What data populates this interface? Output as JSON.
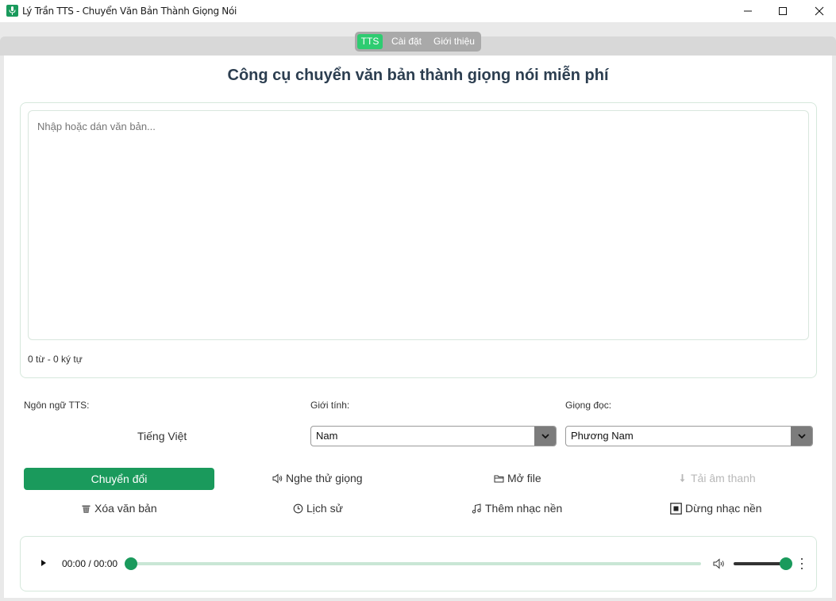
{
  "window": {
    "title": "Lý Trần TTS - Chuyển Văn Bản Thành Giọng Nói"
  },
  "tabs": [
    {
      "label": "TTS",
      "active": true
    },
    {
      "label": "Cài đặt",
      "active": false
    },
    {
      "label": "Giới thiệu",
      "active": false
    }
  ],
  "heading": "Công cụ chuyển văn bản thành giọng nói miễn phí",
  "editor": {
    "placeholder": "Nhập hoặc dán văn bản...",
    "value": "",
    "counter": "0 từ - 0 ký tự"
  },
  "settings": {
    "language_label": "Ngôn ngữ TTS:",
    "language_value": "Tiếng Việt",
    "gender_label": "Giới tính:",
    "gender_value": "Nam",
    "voice_label": "Giọng đọc:",
    "voice_value": "Phương Nam"
  },
  "actions": {
    "convert": "Chuyển đổi",
    "preview_voice": "Nghe thử giọng",
    "open_file": "Mở file",
    "download_audio": "Tải âm thanh",
    "clear_text": "Xóa văn bản",
    "history": "Lịch sử",
    "add_music": "Thêm nhạc nền",
    "stop_music": "Dừng nhạc nền"
  },
  "player": {
    "time": "00:00 / 00:00",
    "progress": 0,
    "volume": 1
  },
  "colors": {
    "accent": "#1a9a5c",
    "tab_active": "#2ecc71",
    "heading": "#2c3e50"
  },
  "icons": [
    "microphone-icon",
    "speaker-icon",
    "folder-icon",
    "download-icon",
    "trash-icon",
    "clock-icon",
    "music-note-icon",
    "stop-icon",
    "play-icon",
    "volume-icon",
    "more-icon",
    "chevron-down-icon"
  ]
}
